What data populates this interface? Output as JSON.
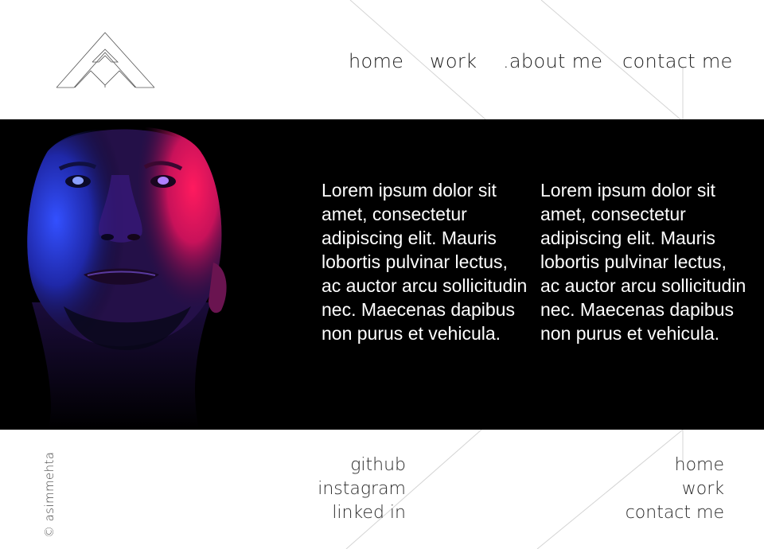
{
  "header": {
    "logo_icon": "triangle-chevron-logo",
    "nav": [
      {
        "label": "home"
      },
      {
        "label": "work"
      },
      {
        "label": ".about me"
      },
      {
        "label": "contact me"
      }
    ]
  },
  "hero": {
    "image": "portrait-face-lit-pink-blue",
    "columns": [
      {
        "text": "Lorem ipsum dolor sit amet, consectetur adipiscing elit. Mauris lobortis pulvinar lectus, ac auctor arcu sollicitudin nec. Maecenas dapibus non purus et vehicula."
      },
      {
        "text": "Lorem ipsum dolor sit amet, consectetur adipiscing elit. Mauris lobortis pulvinar lectus, ac auctor arcu sollicitudin nec. Maecenas dapibus non purus et vehicula."
      }
    ]
  },
  "footer": {
    "copyright": "© asimmehta",
    "social": [
      {
        "label": "github"
      },
      {
        "label": "instagram"
      },
      {
        "label": "linked in"
      }
    ],
    "nav": [
      {
        "label": "home"
      },
      {
        "label": "work"
      },
      {
        "label": "contact me"
      }
    ]
  },
  "colors": {
    "background": "#ffffff",
    "hero_background": "#000000",
    "hero_text": "#ffffff",
    "text": "#2a2a2a",
    "decorative_lines": "#d0d0d0",
    "accent_pink": "#e0145a",
    "accent_blue": "#2a3fd8"
  }
}
